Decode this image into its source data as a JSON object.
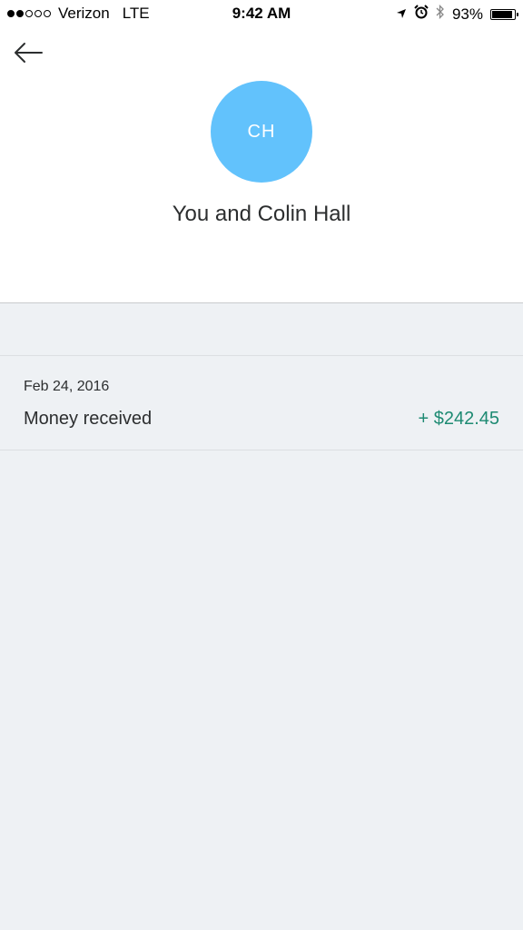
{
  "status_bar": {
    "carrier": "Verizon",
    "network": "LTE",
    "time": "9:42 AM",
    "battery": "93%",
    "battery_level": 0.93,
    "signal_bars": 2
  },
  "header": {
    "avatar_initials": "CH",
    "title": "You and Colin Hall"
  },
  "transactions": [
    {
      "date": "Feb 24, 2016",
      "description": "Money received",
      "amount": "+ $242.45"
    }
  ],
  "colors": {
    "avatar": "#62c2fc",
    "amount_positive": "#1d8a72",
    "background": "#eef1f4"
  }
}
